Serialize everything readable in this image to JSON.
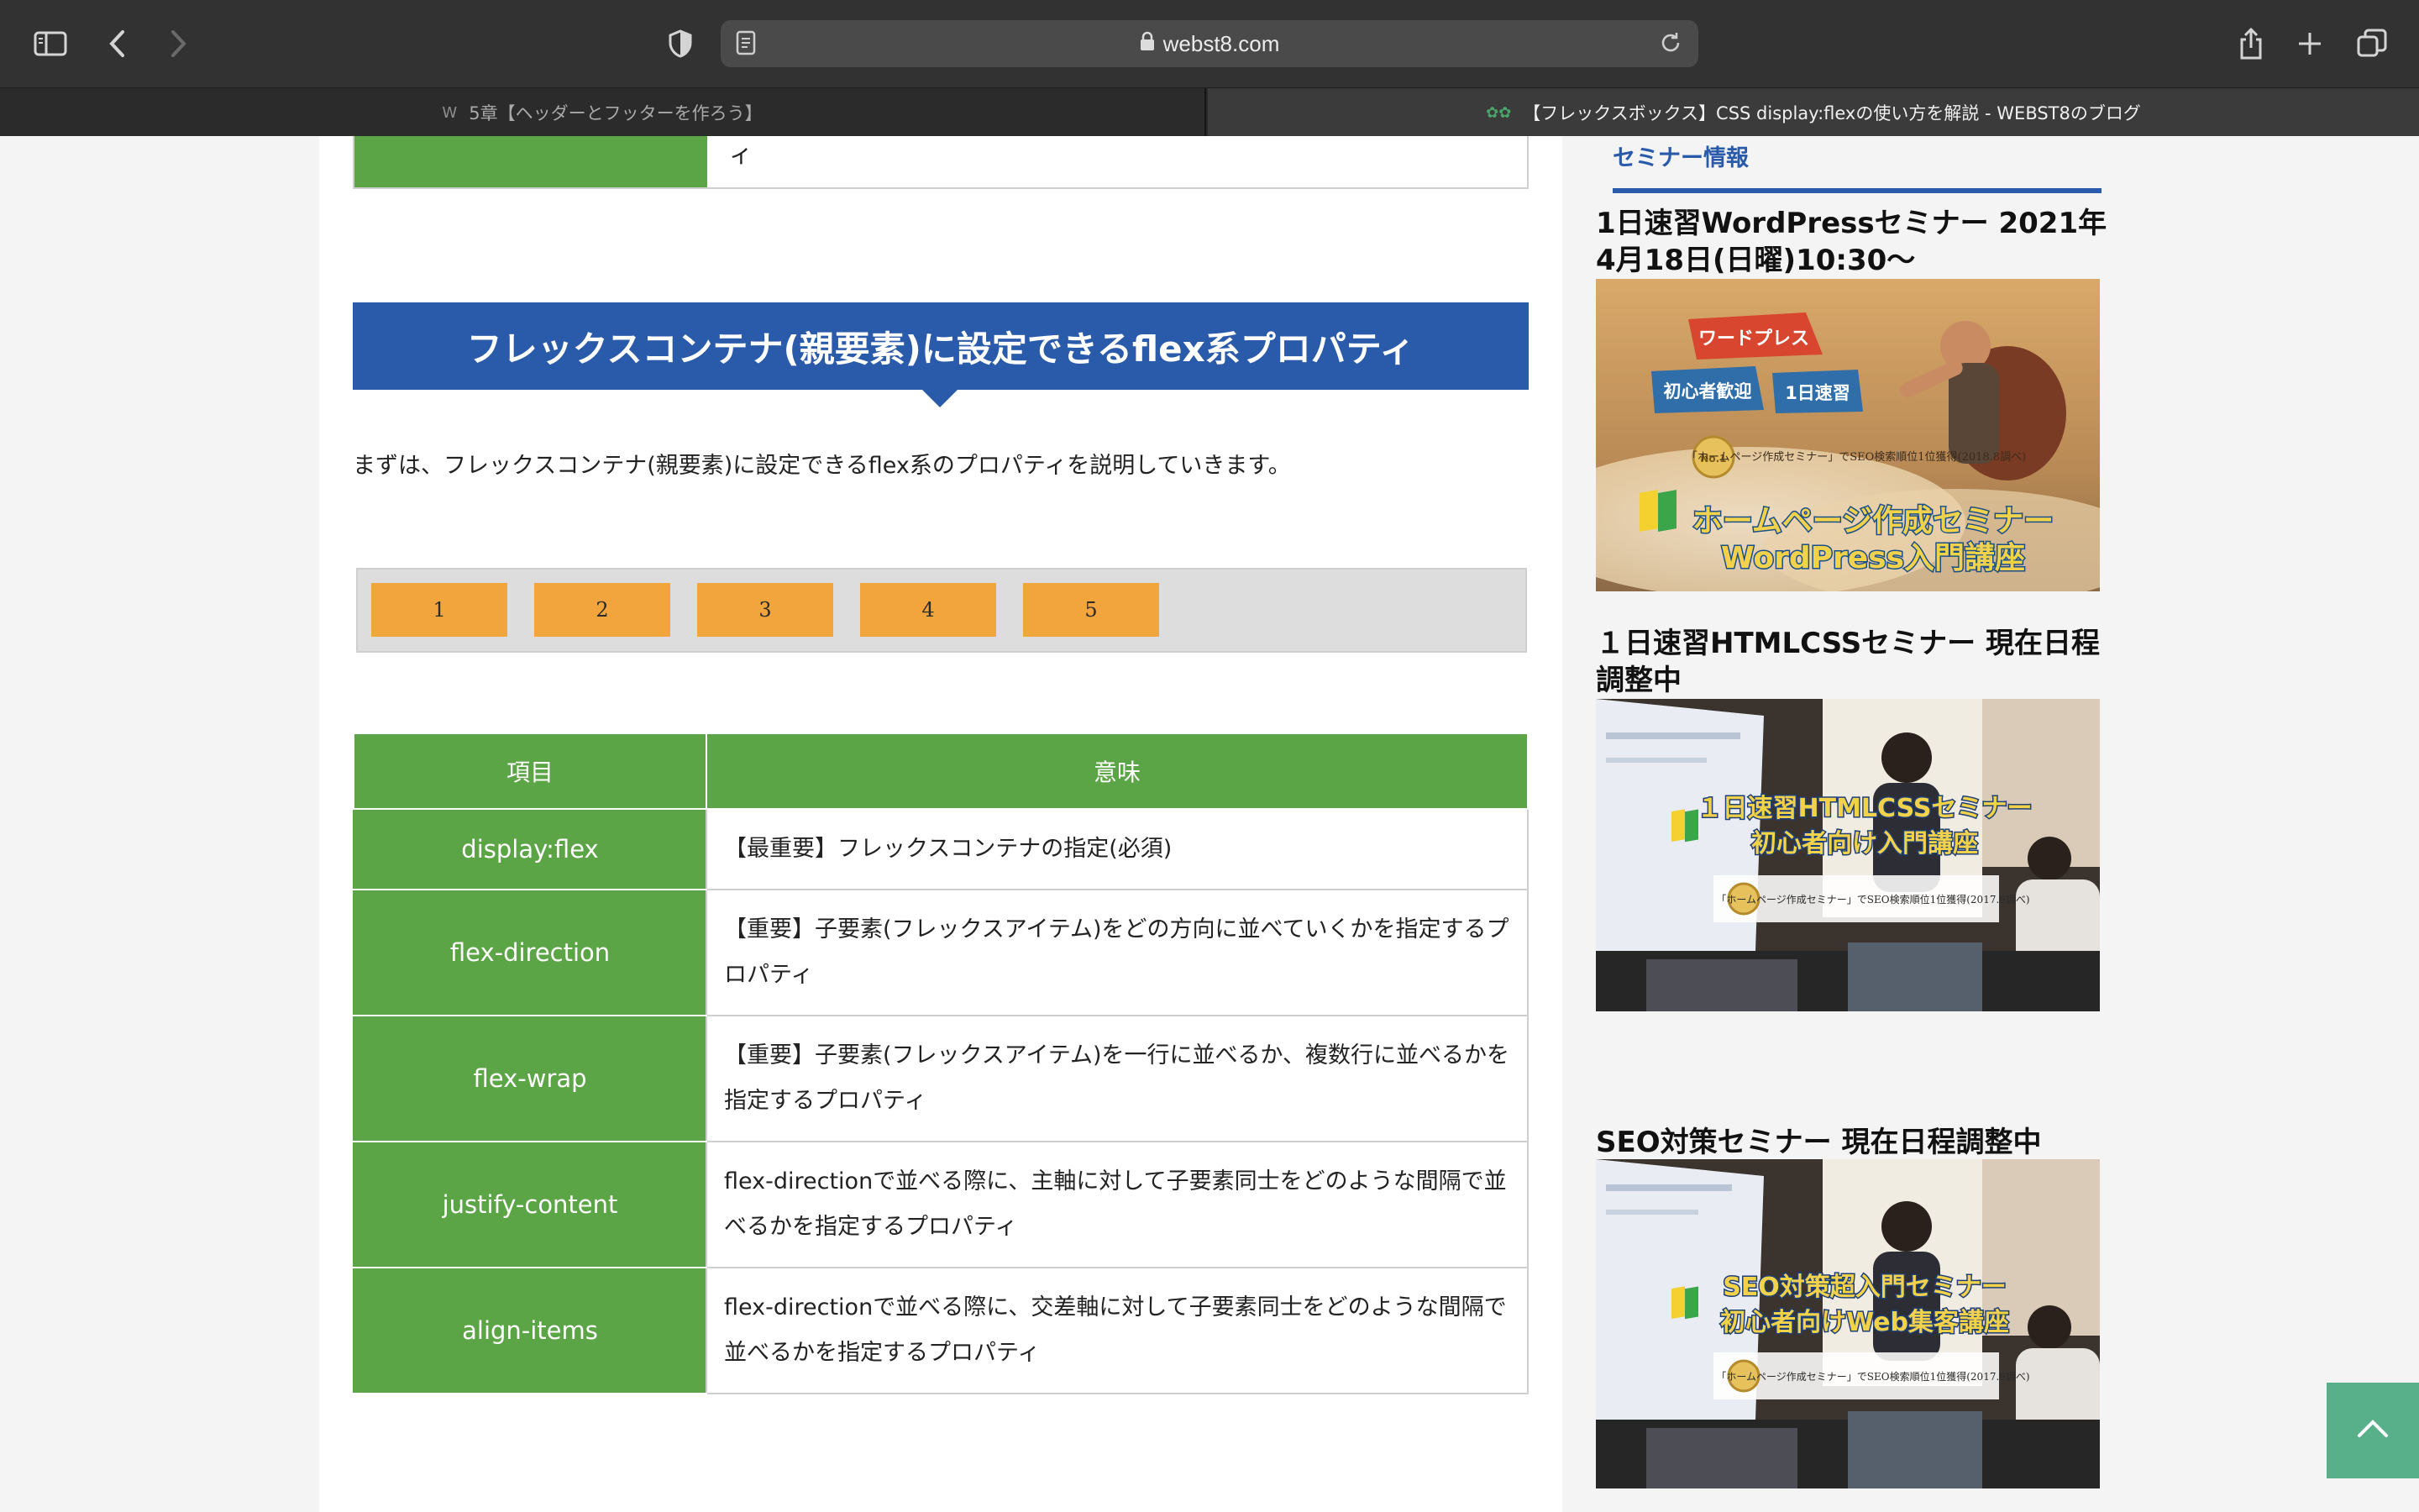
{
  "browser": {
    "url_host": "webst8.com",
    "tabs": [
      {
        "title": "5章【ヘッダーとフッターを作ろう】",
        "favicon": "W"
      },
      {
        "title": "【フレックスボックス】CSS display:flexの使い方を解説 - WEBST8のブログ",
        "favicon": "✿✿"
      }
    ]
  },
  "article": {
    "top_cell_text": "ィ",
    "heading": "フレックスコンテナ(親要素)に設定できるflex系プロパティ",
    "intro": "まずは、フレックスコンテナ(親要素)に設定できるflex系のプロパティを説明していきます。",
    "demo_items": [
      "1",
      "2",
      "3",
      "4",
      "5"
    ],
    "table": {
      "headers": [
        "項目",
        "意味"
      ],
      "rows": [
        {
          "key": "display:flex",
          "value": "【最重要】フレックスコンテナの指定(必須)"
        },
        {
          "key": "flex-direction",
          "value": "【重要】子要素(フレックスアイテム)をどの方向に並べていくかを指定するプロパティ"
        },
        {
          "key": "flex-wrap",
          "value": "【重要】子要素(フレックスアイテム)を一行に並べるか、複数行に並べるかを指定するプロパティ"
        },
        {
          "key": "justify-content",
          "value": "flex-directionで並べる際に、主軸に対して子要素同士をどのような間隔で並べるかを指定するプロパティ"
        },
        {
          "key": "align-items",
          "value": "flex-directionで並べる際に、交差軸に対して子要素同士をどのような間隔で並べるかを指定するプロパティ"
        }
      ]
    }
  },
  "sidebar": {
    "category": "セミナー情報",
    "seminars": [
      {
        "title": "1日速習WordPressセミナー 2021年4月18日(日曜)10:30〜",
        "banner_tags": [
          "ワードプレス",
          "初心者歓迎",
          "1日速習"
        ],
        "banner_award": "「ホームページ作成セミナー」でSEO検索順位1位獲得(2018.8調べ)",
        "banner_title_1": "ホームページ作成セミナー",
        "banner_title_2": "WordPress入門講座"
      },
      {
        "title": "１日速習HTMLCSSセミナー 現在日程調整中",
        "banner_title_1": "１日速習HTMLCSSセミナー",
        "banner_title_2": "初心者向け入門講座",
        "banner_award": "「ホームページ作成セミナー」でSEO検索順位1位獲得(2017.9調べ)"
      },
      {
        "title": "SEO対策セミナー 現在日程調整中",
        "banner_title_1": "SEO対策超入門セミナー",
        "banner_title_2": "初心者向けWeb集客講座",
        "banner_award": "「ホームページ作成セミナー」でSEO検索順位1位獲得(2017.9調べ)"
      }
    ]
  },
  "colors": {
    "accent_blue": "#2a5aaa",
    "table_green": "#5ca546",
    "demo_orange": "#f2a53c",
    "totop_green": "#58b08b"
  }
}
